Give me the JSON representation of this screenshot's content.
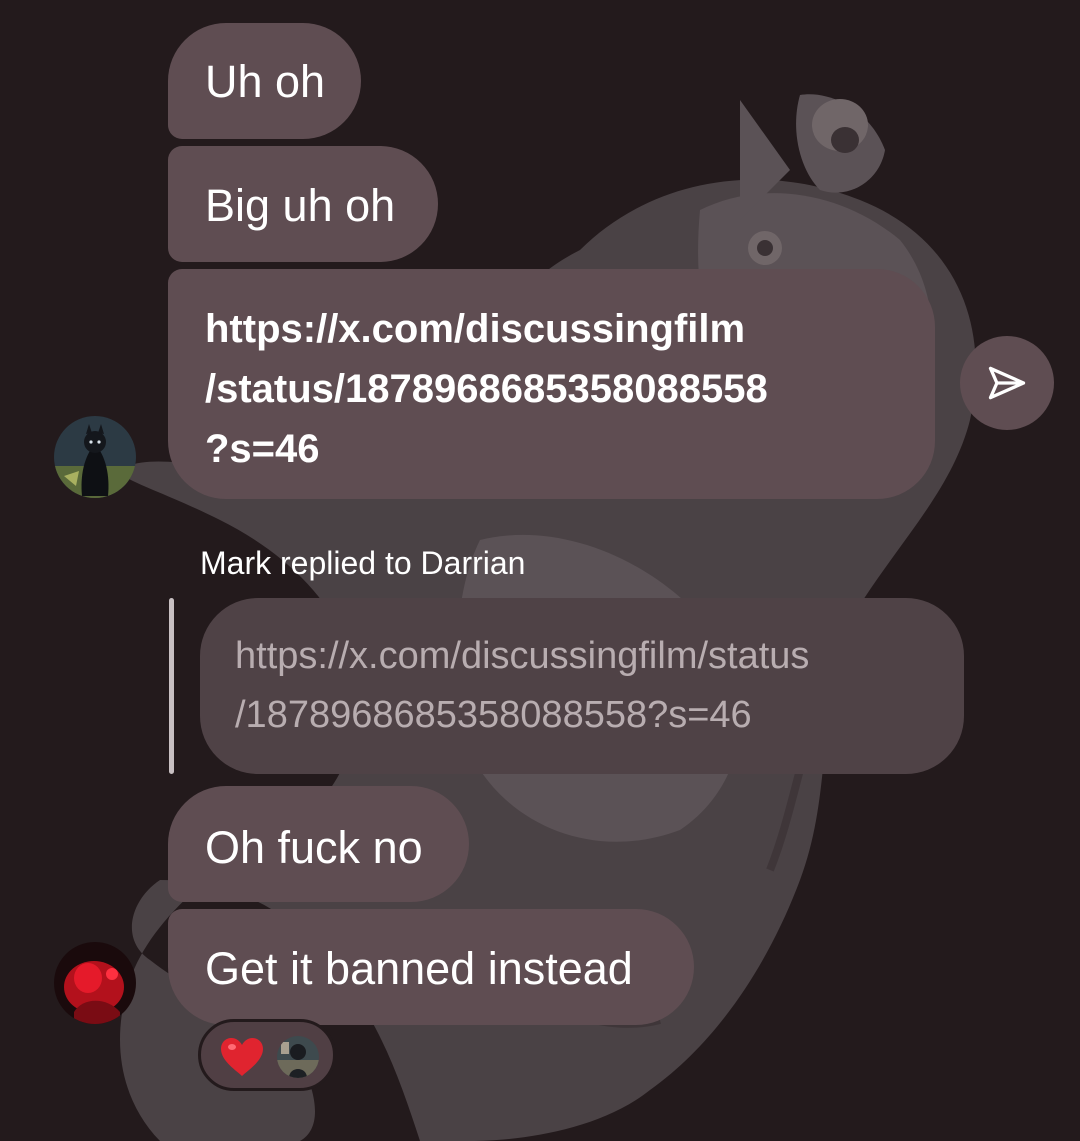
{
  "messages": [
    {
      "text": "Uh oh"
    },
    {
      "text": "Big uh oh"
    },
    {
      "link_lines": [
        "https://x.com/discussingfilm",
        "/status/1878968685358088558",
        "?s=46"
      ]
    },
    {
      "text": "Oh fuck no"
    },
    {
      "text": "Get it banned instead"
    }
  ],
  "reply": {
    "label": "Mark replied to Darrian",
    "quoted_lines": [
      "https://x.com/discussingfilm/status",
      "/1878968685358088558?s=46"
    ]
  },
  "reaction": {
    "emoji_icon": "red-heart-icon"
  },
  "icons": {
    "share": "send-icon"
  },
  "colors": {
    "background": "#231a1c",
    "bubble": "#5f4d52",
    "quoted_text": "#b8adb0",
    "heart": "#e0242f"
  }
}
